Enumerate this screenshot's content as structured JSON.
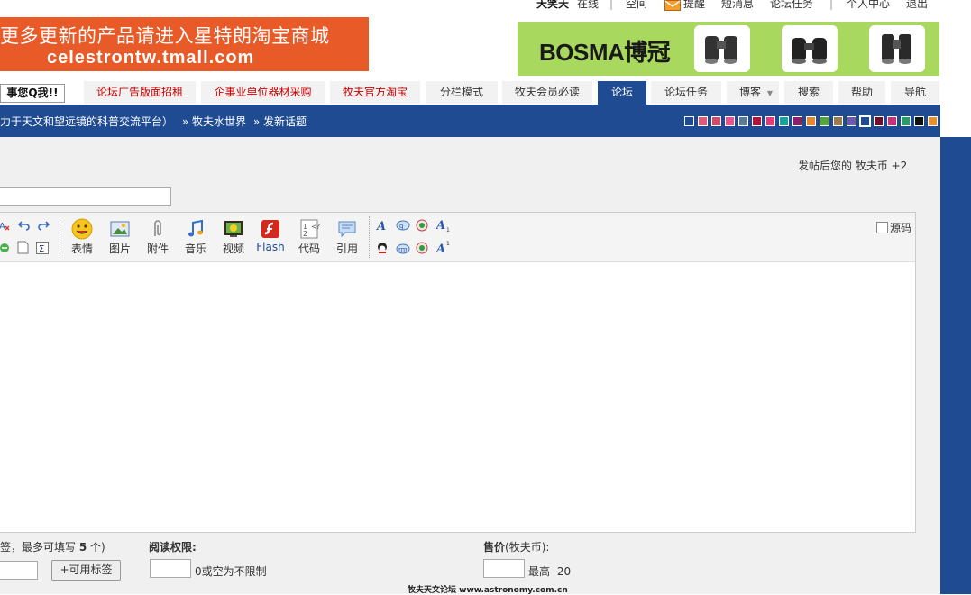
{
  "userbar": {
    "username": "天笑天",
    "status": "在线",
    "space": "空间",
    "remind": "提醒",
    "messages": "短消息",
    "tasks": "论坛任务",
    "center": "个人中心",
    "logout": "退出"
  },
  "ads": {
    "left_line1": "更多更新的产品请进入星特朗淘宝商城",
    "left_line2": "celestrontw.tmall.com",
    "right_brand": "BOSMA博冠"
  },
  "nav": {
    "first": "事您Q我!!",
    "items": [
      "论坛广告版面招租",
      "企事业单位器材采购",
      "牧夫官方淘宝",
      "分栏模式",
      "牧夫会员必读",
      "论坛",
      "论坛任务",
      "博客",
      "搜索",
      "帮助",
      "导航"
    ]
  },
  "breadcrumb": {
    "part1": "力于天文和望远镜的科普交流平台）",
    "part2": "» 牧夫水世界",
    "part3": "» 发新话题"
  },
  "colors": {
    "theme_blue": "#1f4b93",
    "swatches": [
      "#1f4b93",
      "#e05a7a",
      "#d14b6a",
      "#e8548a",
      "#5d7a93",
      "#b3123a",
      "#e03c79",
      "#17a39a",
      "#8c1e6a",
      "#e8882a",
      "#50a83d",
      "#9d7a4a",
      "#6a5ab0",
      "#ffffff",
      "#6e0f2c",
      "#cc2f7b",
      "#2a9a6a",
      "#111111",
      "#e8902a"
    ]
  },
  "post": {
    "credit_text": "发帖后您的 牧夫币 +2"
  },
  "toolbar": {
    "buttons": [
      "表情",
      "图片",
      "附件",
      "音乐",
      "视频",
      "Flash",
      "代码",
      "引用"
    ],
    "source_label": "源码"
  },
  "options": {
    "tags_label_prefix": "签，最多可填写 ",
    "tags_max": "5",
    "tags_label_suffix": " 个)",
    "tags_button": "+可用标签",
    "read_perm_label": "阅读权限:",
    "read_perm_hint": "0或空为不限制",
    "price_label": "售价",
    "price_unit": "(牧夫币):",
    "price_max_label": "最高",
    "price_max": "20"
  },
  "footer": "牧夫天文论坛 www.astronomy.com.cn"
}
